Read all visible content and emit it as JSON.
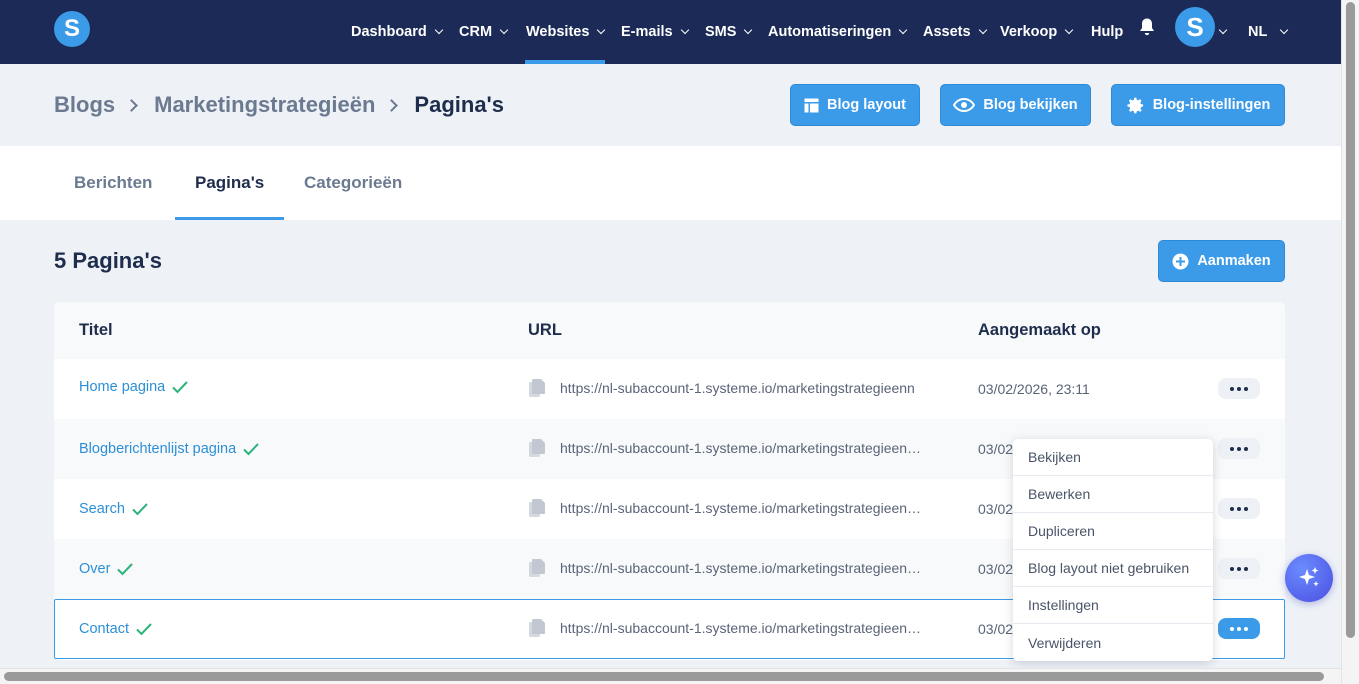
{
  "nav": {
    "logo_letter": "S",
    "items": [
      {
        "label": "Dashboard"
      },
      {
        "label": "CRM"
      },
      {
        "label": "Websites"
      },
      {
        "label": "E-mails"
      },
      {
        "label": "SMS"
      },
      {
        "label": "Automatiseringen"
      },
      {
        "label": "Assets"
      },
      {
        "label": "Verkoop"
      }
    ],
    "help_label": "Hulp",
    "avatar_letter": "S",
    "language": "NL",
    "active_item": "Websites"
  },
  "breadcrumb": {
    "items": [
      "Blogs",
      "Marketingstrategieën"
    ],
    "current": "Pagina's"
  },
  "header_buttons": {
    "layout": "Blog layout",
    "view": "Blog bekijken",
    "settings": "Blog-instellingen"
  },
  "tabs": {
    "items": [
      {
        "label": "Berichten"
      },
      {
        "label": "Pagina's"
      },
      {
        "label": "Categorieën"
      }
    ],
    "active": "Pagina's"
  },
  "page": {
    "count_label": "5 Pagina's",
    "create_button": "Aanmaken"
  },
  "table": {
    "columns": {
      "title": "Titel",
      "url": "URL",
      "created": "Aangemaakt op"
    },
    "rows": [
      {
        "title": "Home pagina",
        "url": "https://nl-subaccount-1.systeme.io/marketingstrategieenn",
        "created": "03/02/2026, 23:11"
      },
      {
        "title": "Blogberichtenlijst pagina",
        "url": "https://nl-subaccount-1.systeme.io/marketingstrategieen…",
        "created": "03/02"
      },
      {
        "title": "Search",
        "url": "https://nl-subaccount-1.systeme.io/marketingstrategieen…",
        "created": "03/02"
      },
      {
        "title": "Over",
        "url": "https://nl-subaccount-1.systeme.io/marketingstrategieen…",
        "created": "03/02"
      },
      {
        "title": "Contact",
        "url": "https://nl-subaccount-1.systeme.io/marketingstrategieen…",
        "created": "03/02"
      }
    ]
  },
  "context_menu": {
    "items": [
      "Bekijken",
      "Bewerken",
      "Dupliceren",
      "Blog layout niet gebruiken",
      "Instellingen",
      "Verwijderen"
    ]
  },
  "colors": {
    "nav_bg": "#1b2a57",
    "accent": "#3b9be8",
    "link": "#2c8fd6",
    "check": "#2bb37a"
  }
}
